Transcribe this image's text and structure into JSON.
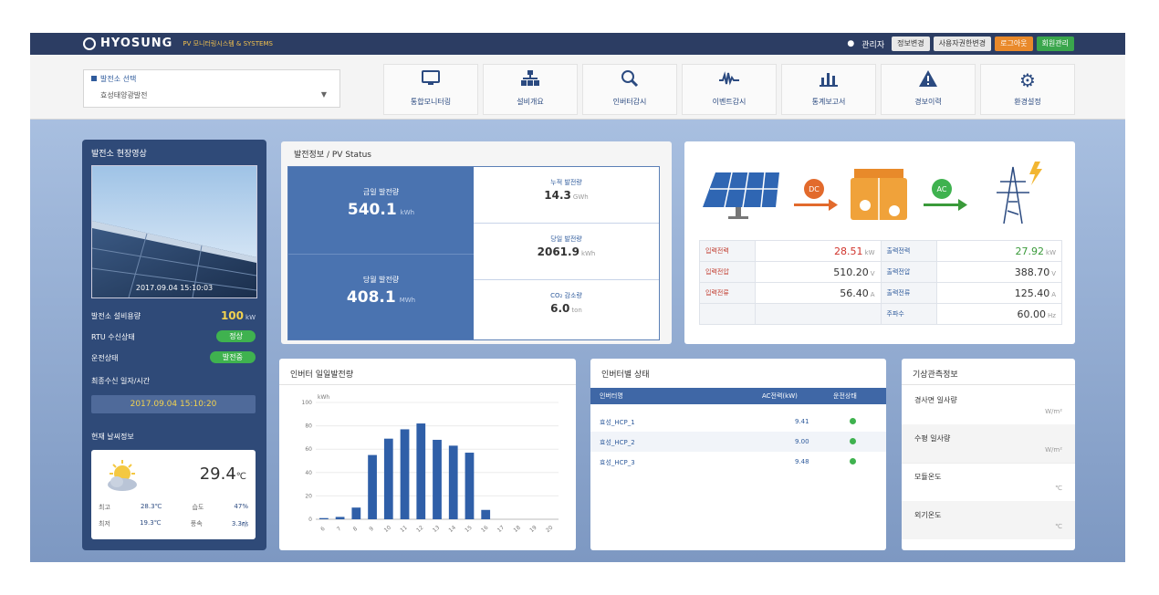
{
  "header": {
    "logo": "HYOSUNG",
    "logo_sub": "PV 모니터링시스템 & SYSTEMS",
    "user": "관리자",
    "buttons": [
      "정보변경",
      "사용자권한변경",
      "로그아웃",
      "회원관리"
    ],
    "colors": {
      "bar": "#2c3d63",
      "orange": "#e9892a",
      "green": "#3aa64c"
    }
  },
  "selector": {
    "label": "발전소 선택",
    "value": "효성태양광발전"
  },
  "nav": [
    {
      "label": "통합모니터링",
      "icon": "monitor-icon"
    },
    {
      "label": "설비개요",
      "icon": "hierarchy-icon"
    },
    {
      "label": "인버터감시",
      "icon": "magnifier-icon"
    },
    {
      "label": "이벤트감시",
      "icon": "waveform-icon"
    },
    {
      "label": "통계보고서",
      "icon": "bar-chart-icon"
    },
    {
      "label": "경보이력",
      "icon": "warning-icon"
    },
    {
      "label": "환경설정",
      "icon": "gear-icon"
    }
  ],
  "plant": {
    "title": "발전소 현장영상",
    "photo_time": "2017.09.04 15:10:03",
    "capacity_label": "발전소 설비용량",
    "capacity_value": "100",
    "capacity_unit": "kW",
    "rtu_label": "RTU 수신상태",
    "rtu_status": "정상",
    "op_label": "운전상태",
    "op_status": "발전중",
    "last_label": "최종수신 일자/시간",
    "last_time": "2017.09.04 15:10:20",
    "weather_title": "현재 날씨정보",
    "temperature": "29.4",
    "temp_unit": "℃",
    "weather_rows": [
      {
        "k1": "최고",
        "v1": "28.3℃",
        "k2": "습도",
        "v2": "47%"
      },
      {
        "k1": "최저",
        "v1": "19.3℃",
        "k2": "풍속",
        "v2": "3.3㎧"
      }
    ]
  },
  "pv_status": {
    "title": "발전정보 / PV Status",
    "today_label": "금일 발전량",
    "today_value": "540.1",
    "today_unit": "kWh",
    "month_label": "당월 발전량",
    "month_value": "408.1",
    "month_unit": "MWh",
    "total_label": "누적 발전량",
    "total_value": "14.3",
    "total_unit": "GWh",
    "yesterday_label": "당일 발전량",
    "yesterday_value": "2061.9",
    "yesterday_unit": "kWh",
    "co2_label": "CO₂ 감소량",
    "co2_value": "6.0",
    "co2_unit": "ton"
  },
  "flow": {
    "dc_label": "DC",
    "ac_label": "AC",
    "rows": [
      {
        "k1": "입력전력",
        "v1": "28.51",
        "u1": "kW",
        "k2": "출력전력",
        "v2": "27.92",
        "u2": "kW"
      },
      {
        "k1": "입력전압",
        "v1": "510.20",
        "u1": "V",
        "k2": "출력전압",
        "v2": "388.70",
        "u2": "V"
      },
      {
        "k1": "입력전류",
        "v1": "56.40",
        "u1": "A",
        "k2": "출력전류",
        "v2": "125.40",
        "u2": "A"
      },
      {
        "k1": "",
        "v1": "",
        "u1": "",
        "k2": "주파수",
        "v2": "60.00",
        "u2": "Hz"
      }
    ]
  },
  "hourly": {
    "title": "인버터 일일발전량",
    "ylabel": "kWh"
  },
  "chart_data": {
    "type": "bar",
    "title": "인버터 일일발전량",
    "ylabel": "kWh",
    "ylim": [
      0,
      100
    ],
    "categories": [
      "6",
      "7",
      "8",
      "9",
      "10",
      "11",
      "12",
      "13",
      "14",
      "15",
      "16",
      "17",
      "18",
      "19",
      "20"
    ],
    "values": [
      1,
      2,
      10,
      55,
      69,
      77,
      82,
      68,
      63,
      57,
      8,
      0,
      0,
      0,
      0
    ]
  },
  "inverters": {
    "title": "인버터별 상태",
    "headers": [
      "인버터명",
      "AC전력(kW)",
      "운전상태"
    ],
    "rows": [
      {
        "name": "효성_HCP_1",
        "power": "9.41"
      },
      {
        "name": "효성_HCP_2",
        "power": "9.00"
      },
      {
        "name": "효성_HCP_3",
        "power": "9.48"
      }
    ]
  },
  "weather_sensor": {
    "title": "기상관측정보",
    "items": [
      {
        "label": "경사면 일사량",
        "unit": "W/m²"
      },
      {
        "label": "수평 일사량",
        "unit": "W/m²"
      },
      {
        "label": "모듈온도",
        "unit": "℃"
      },
      {
        "label": "외기온도",
        "unit": "℃"
      }
    ]
  }
}
